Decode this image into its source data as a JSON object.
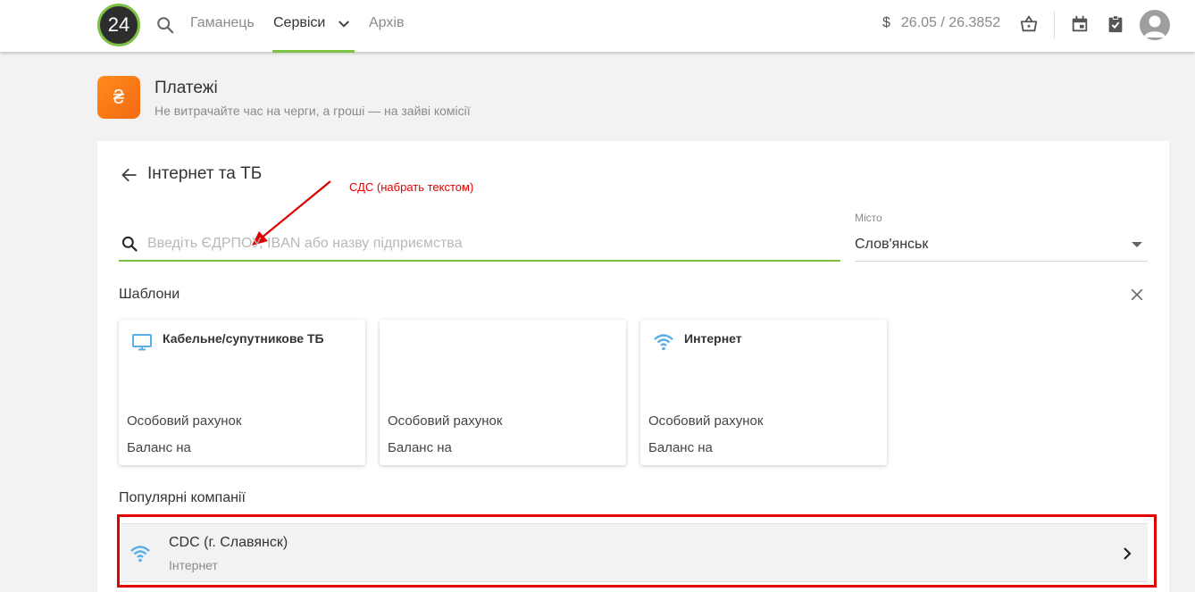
{
  "topbar": {
    "logo_text": "24",
    "nav": {
      "wallet": "Гаманець",
      "services": "Сервіси",
      "archive": "Архів"
    },
    "rate": {
      "currency_sign": "$",
      "value": "26.05 / 26.3852"
    },
    "icons": [
      "search-icon",
      "chevron-down-icon",
      "basket-icon",
      "calendar-icon",
      "clipboard-check-icon",
      "avatar"
    ]
  },
  "header": {
    "icon_glyph": "₴",
    "title": "Платежі",
    "subtitle": "Не витрачайте час на черги, а гроші — на зайві комісії"
  },
  "section": {
    "title": "Інтернет та ТБ"
  },
  "annotation": {
    "text": "СДС (набрать текстом)"
  },
  "search": {
    "placeholder": "Введіть ЄДРПОУ, IBAN або назву підприємства",
    "value": ""
  },
  "city": {
    "label": "Місто",
    "value": "Слов'янськ"
  },
  "templates": {
    "title": "Шаблони",
    "items": [
      {
        "name": "Кабельне/супутникове ТБ",
        "icon": "tv-icon",
        "account_label": "Особовий рахунок",
        "balance_label": "Баланс на"
      },
      {
        "name": "",
        "icon": "",
        "account_label": "Особовий рахунок",
        "balance_label": "Баланс на"
      },
      {
        "name": "Интернет",
        "icon": "wifi-icon",
        "account_label": "Особовий рахунок",
        "balance_label": "Баланс на"
      }
    ]
  },
  "popular": {
    "title": "Популярні компанії",
    "items": [
      {
        "name": "CDC (г. Славянск)",
        "category": "Інтернет",
        "icon": "wifi-icon"
      }
    ]
  },
  "colors": {
    "accent_green": "#7cc242",
    "orange": "#f36b12",
    "annotation_red": "#e00000",
    "icon_blue": "#5aaee8"
  }
}
